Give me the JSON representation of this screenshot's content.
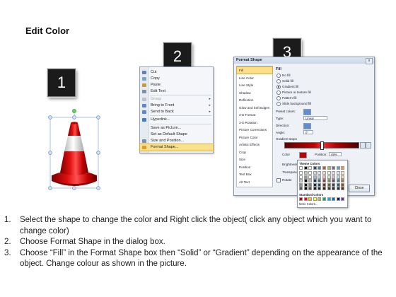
{
  "title": "Edit Color",
  "steps": [
    "1",
    "2",
    "3"
  ],
  "context_menu": {
    "items": [
      {
        "label": "Cut",
        "icon": "scissors-icon",
        "color": "#6a7fb0"
      },
      {
        "label": "Copy",
        "icon": "copy-icon",
        "color": "#7aa0d4"
      },
      {
        "label": "Paste",
        "icon": "paste-icon",
        "color": "#c89a3a"
      },
      {
        "label": "Edit Text",
        "icon": "edit-text-icon",
        "color": "#7e8fa8"
      },
      {
        "label": "Group",
        "icon": "group-icon",
        "color": "#b9c3d2",
        "disabled": true,
        "submenu": true
      },
      {
        "label": "Bring to Front",
        "icon": "bring-front-icon",
        "color": "#5b86c8",
        "submenu": true
      },
      {
        "label": "Send to Back",
        "icon": "send-back-icon",
        "color": "#5b86c8",
        "submenu": true
      },
      {
        "label": "Hyperlink...",
        "icon": "hyperlink-icon",
        "color": "#3f7bd0"
      },
      {
        "label": "Save as Picture...",
        "icon": "",
        "color": ""
      },
      {
        "label": "Set as Default Shape",
        "icon": "",
        "color": ""
      },
      {
        "label": "Size and Position...",
        "icon": "size-position-icon",
        "color": "#7e8fa8"
      },
      {
        "label": "Format Shape...",
        "icon": "format-shape-icon",
        "color": "#e59a2c",
        "highlighted": true
      }
    ]
  },
  "format_dialog": {
    "title": "Format Shape",
    "close_x": "x",
    "categories": [
      "Fill",
      "Line Color",
      "Line Style",
      "Shadow",
      "Reflection",
      "Glow and Soft Edges",
      "3-D Format",
      "3-D Rotation",
      "Picture Corrections",
      "Picture Color",
      "Artistic Effects",
      "Crop",
      "Size",
      "Position",
      "Text Box",
      "Alt Text"
    ],
    "section": "Fill",
    "fill_options": [
      {
        "label": "No fill",
        "checked": false
      },
      {
        "label": "Solid fill",
        "checked": false
      },
      {
        "label": "Gradient fill",
        "checked": true
      },
      {
        "label": "Picture or texture fill",
        "checked": false
      },
      {
        "label": "Pattern fill",
        "checked": false
      },
      {
        "label": "Slide background fill",
        "checked": false
      }
    ],
    "preset_colors_label": "Preset colors:",
    "type_label": "Type:",
    "type_value": "Linear",
    "direction_label": "Direction:",
    "angle_label": "Angle:",
    "angle_value": "0°",
    "gradient_stops_label": "Gradient stops",
    "color_label": "Color",
    "position_label": "Position:",
    "position_value": "49%",
    "brightness_label": "Brightness",
    "transparency_label": "Transparen",
    "rotate_label": "Rotate",
    "close_button": "Close"
  },
  "palette": {
    "theme_header": "Theme Colors",
    "standard_header": "Standard Colors",
    "more_colors": "More Colors...",
    "theme_top": [
      "#ffffff",
      "#000000",
      "#eeece1",
      "#1f497d",
      "#4f81bd",
      "#c0504d",
      "#9bbb59",
      "#8064a2",
      "#4bacc6",
      "#f79646"
    ],
    "standard": [
      "#c00000",
      "#ff0000",
      "#ffc000",
      "#ffff00",
      "#92d050",
      "#00b050",
      "#00b0f0",
      "#0070c0",
      "#002060",
      "#7030a0"
    ]
  },
  "instructions": [
    {
      "num": "1.",
      "text": "Select the shape to change the color and Right click the object( click any object which you want to change color)"
    },
    {
      "num": "2.",
      "text": "Choose Format Shape in the dialog box."
    },
    {
      "num": "3.",
      "text": "Choose “Fill” in the Format Shape box then “Solid” or “Gradient” depending on the appearance of the object. Change colour as shown in the picture."
    }
  ]
}
